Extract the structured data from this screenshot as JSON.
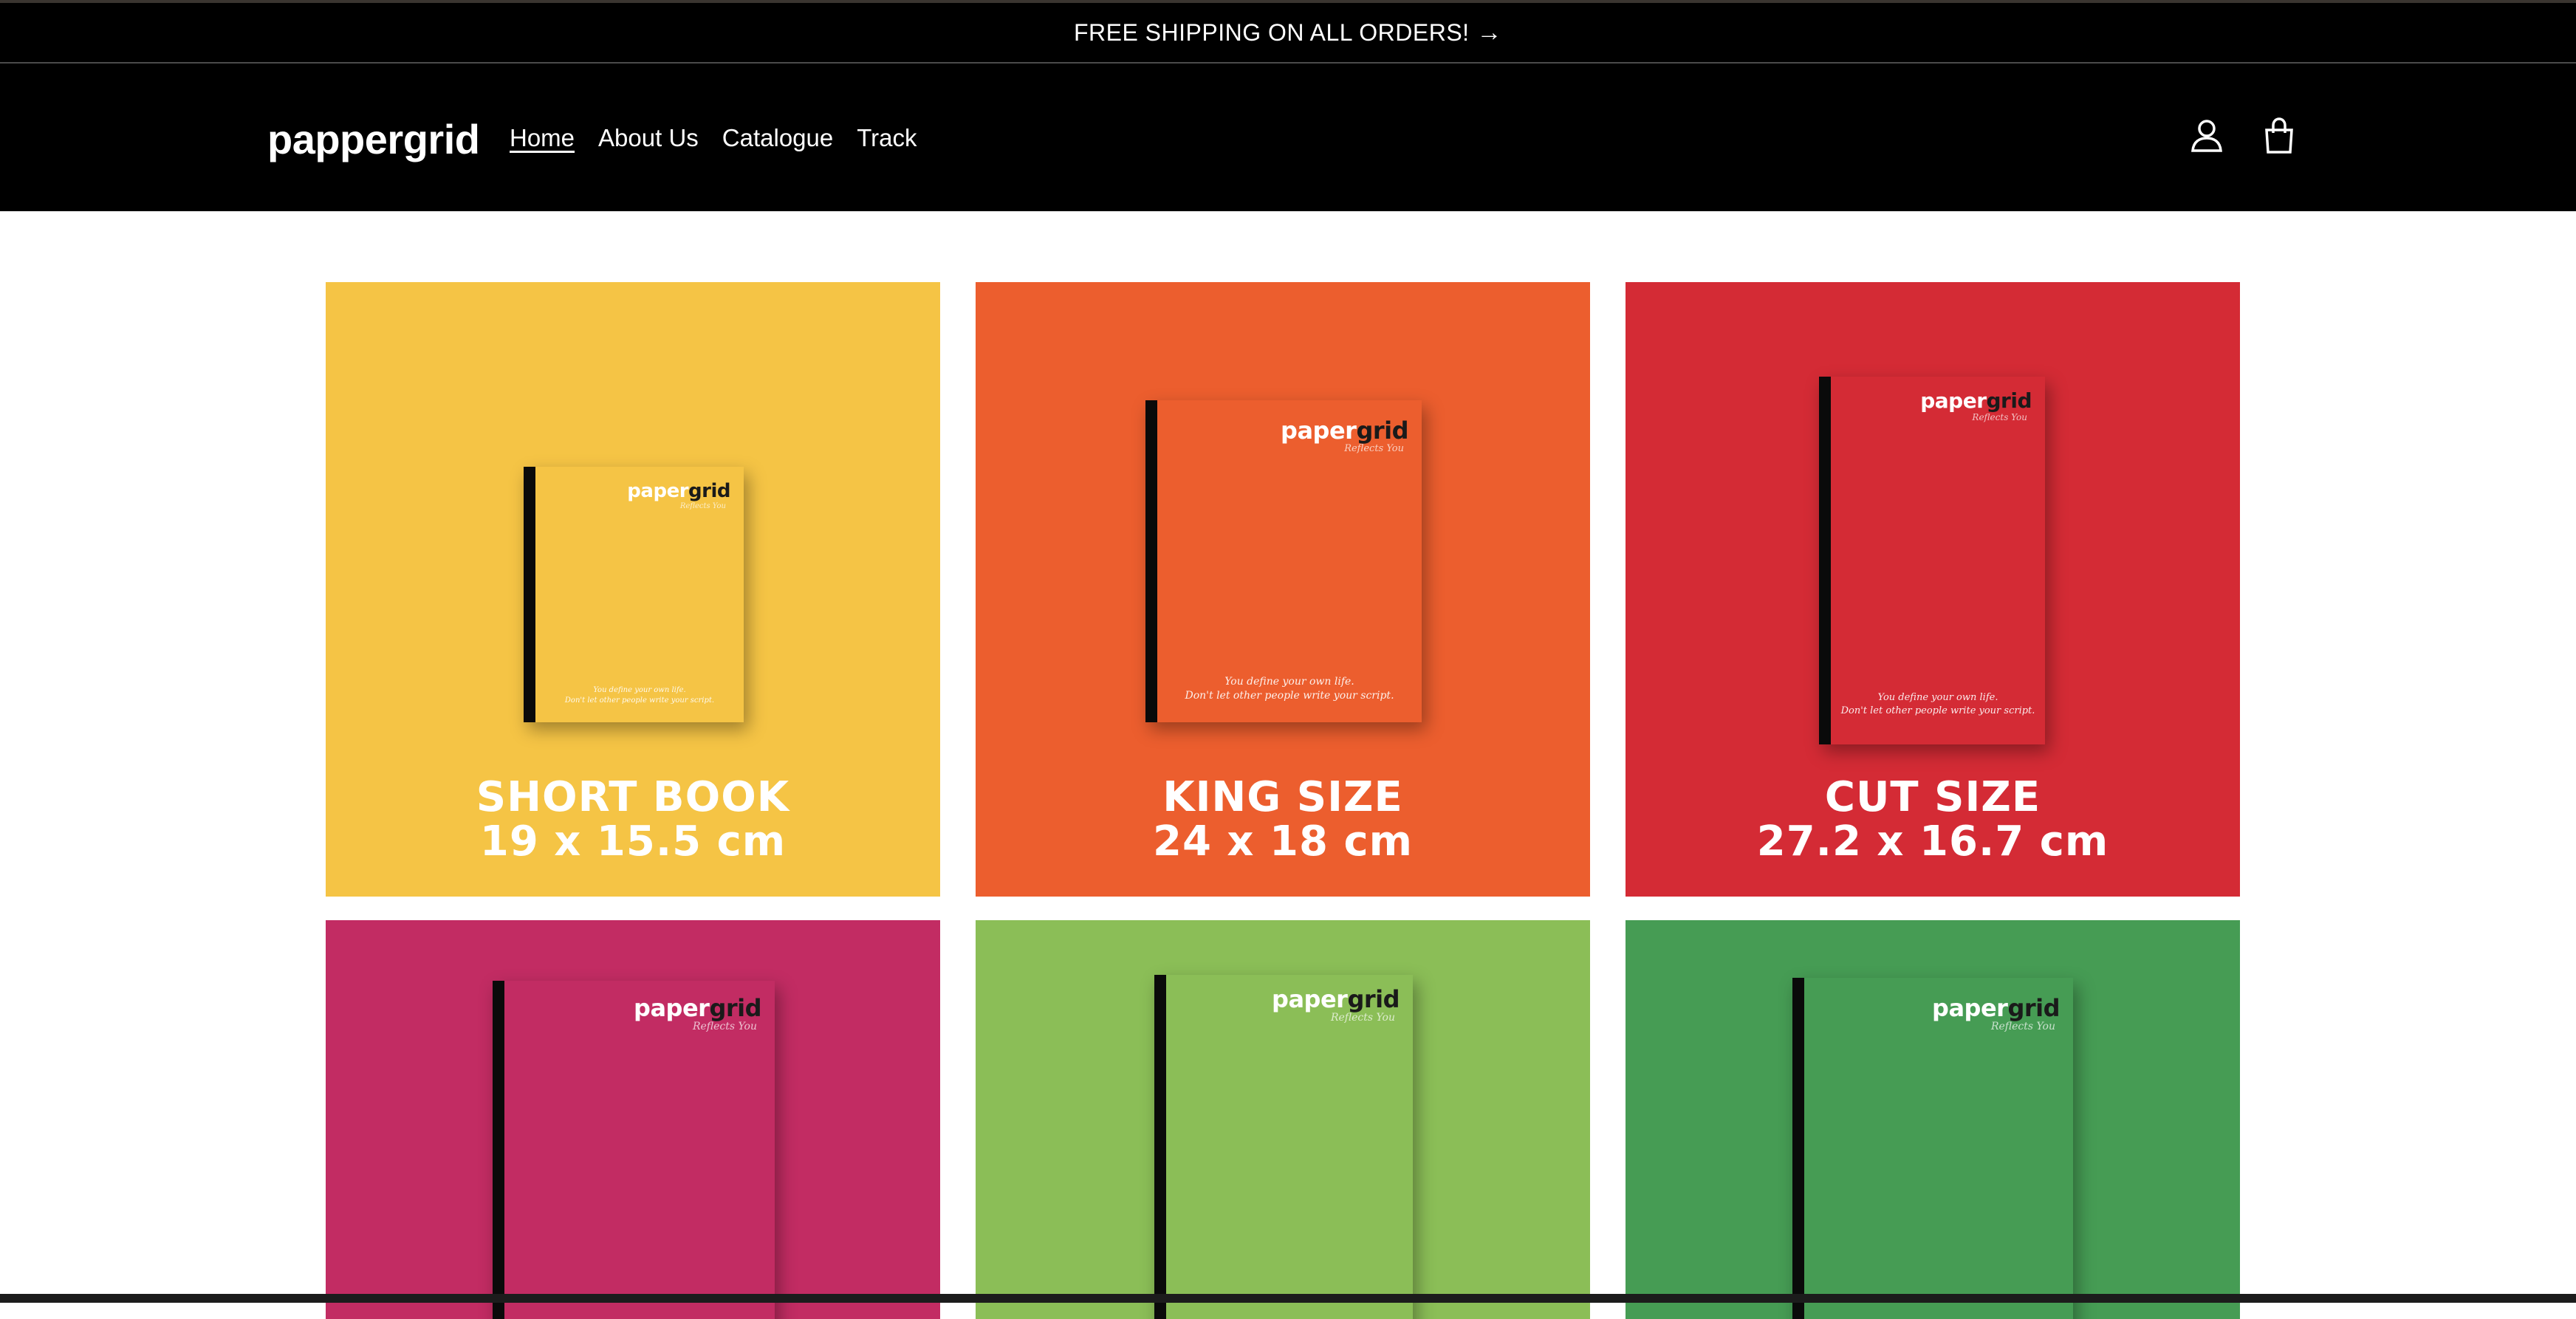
{
  "announcement": {
    "text": "FREE SHIPPING ON ALL ORDERS!",
    "arrow": "→"
  },
  "header": {
    "logo": "pappergrid",
    "nav": [
      {
        "label": "Home",
        "active": true
      },
      {
        "label": "About Us"
      },
      {
        "label": "Catalogue"
      },
      {
        "label": "Track"
      }
    ],
    "icons": [
      "account-icon",
      "cart-icon"
    ]
  },
  "book": {
    "brand_a": "paper",
    "brand_b": "grid",
    "tagline": "Reflects You",
    "quote_line1": "You define your own life.",
    "quote_line2": "Don't let other people write your script."
  },
  "products": [
    {
      "title": "SHORT BOOK",
      "size": "19 x 15.5 cm",
      "color": "#F5C445"
    },
    {
      "title": "KING SIZE",
      "size": "24 x 18 cm",
      "color": "#EC5E2E"
    },
    {
      "title": "CUT SIZE",
      "size": "27.2 x 16.7 cm",
      "color": "#D42B35"
    },
    {
      "title": "",
      "size": "",
      "color": "#C22C63"
    },
    {
      "title": "",
      "size": "",
      "color": "#8BBE57"
    },
    {
      "title": "",
      "size": "",
      "color": "#469C54"
    }
  ]
}
